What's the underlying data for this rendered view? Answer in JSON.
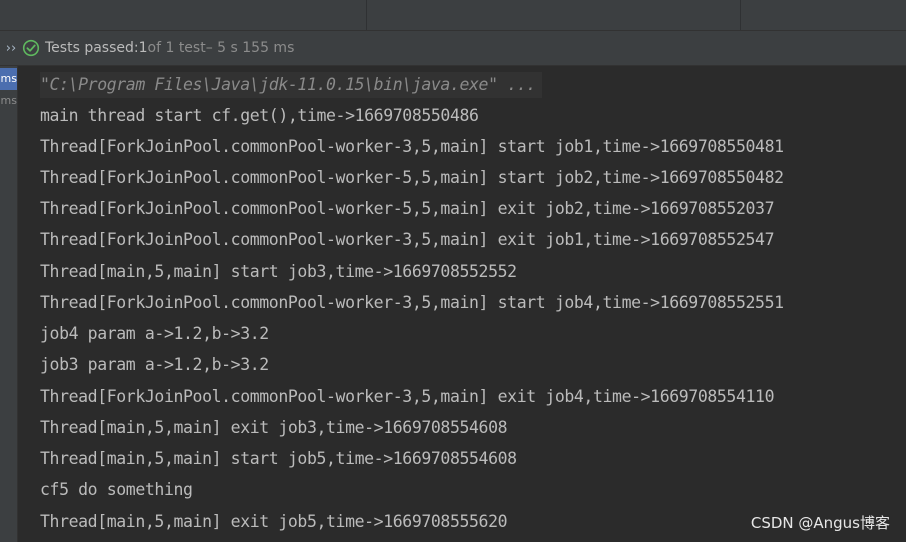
{
  "status": {
    "label_main": "Tests passed: ",
    "count": "1",
    "label_of": " of 1 test",
    "duration": " – 5 s 155 ms",
    "expand_icon": "double-chevron-right-icon",
    "passed_icon": "check-circle-icon",
    "passed_color": "#5fb85f"
  },
  "test_tree": {
    "items": [
      {
        "label": "ms",
        "selected": true
      },
      {
        "label": "ms",
        "selected": false
      }
    ]
  },
  "console": {
    "lines": [
      "\"C:\\Program Files\\Java\\jdk-11.0.15\\bin\\java.exe\" ...",
      "main thread start cf.get(),time->1669708550486",
      "Thread[ForkJoinPool.commonPool-worker-3,5,main] start job1,time->1669708550481",
      "Thread[ForkJoinPool.commonPool-worker-5,5,main] start job2,time->1669708550482",
      "Thread[ForkJoinPool.commonPool-worker-5,5,main] exit job2,time->1669708552037",
      "Thread[ForkJoinPool.commonPool-worker-3,5,main] exit job1,time->1669708552547",
      "Thread[main,5,main] start job3,time->1669708552552",
      "Thread[ForkJoinPool.commonPool-worker-3,5,main] start job4,time->1669708552551",
      "job4 param a->1.2,b->3.2",
      "job3 param a->1.2,b->3.2",
      "Thread[ForkJoinPool.commonPool-worker-3,5,main] exit job4,time->1669708554110",
      "Thread[main,5,main] exit job3,time->1669708554608",
      "Thread[main,5,main] start job5,time->1669708554608",
      "cf5 do something",
      "Thread[main,5,main] exit job5,time->1669708555620"
    ]
  },
  "watermark": "CSDN @Angus博客"
}
